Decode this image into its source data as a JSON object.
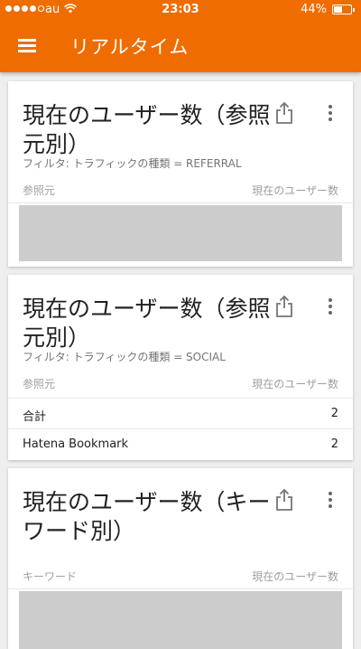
{
  "status_bar": {
    "carrier": "au",
    "time": "23:03",
    "battery": "44%",
    "battery_level": 0.44
  },
  "header": {
    "title": "リアルタイム",
    "background": "#ef6c00"
  },
  "cards": [
    {
      "title": "現在のユーザー数（参照元別）",
      "filter": "フィルタ: トラフィックの種類 = REFERRAL",
      "col_left": "参照元",
      "col_right": "現在のユーザー数"
    },
    {
      "title": "現在のユーザー数（参照元別）",
      "filter": "フィルタ: トラフィックの種類 = SOCIAL",
      "col_left": "参照元",
      "col_right": "現在のユーザー数",
      "rows": [
        {
          "label": "合計",
          "value": "2"
        },
        {
          "label": "Hatena Bookmark",
          "value": "2"
        }
      ]
    },
    {
      "title": "現在のユーザー数（キーワード別）",
      "col_left": "キーワード",
      "col_right": "現在のユーザー数"
    }
  ],
  "icons": {
    "menu": "hamburger-menu-icon",
    "share": "share-icon",
    "more": "more-vertical-icon",
    "wifi": "wifi-icon",
    "battery": "battery-icon"
  }
}
